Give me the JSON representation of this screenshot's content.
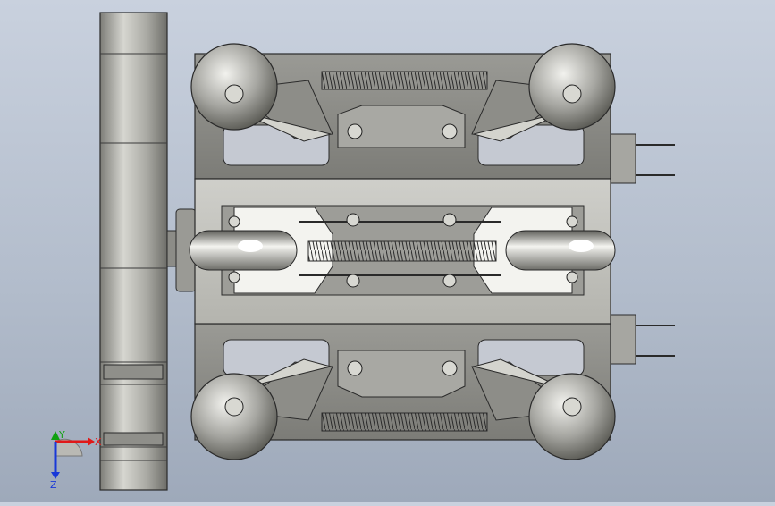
{
  "viewport": {
    "background_top": "#c9d1de",
    "background_bottom": "#9ea9ba",
    "part_color": "#b9b9b4",
    "edge_color": "#2a2a2a"
  },
  "triad": {
    "x_label": "X",
    "y_label": "Y",
    "z_label": "Z",
    "x_color": "#e01818",
    "y_color": "#10a010",
    "z_color": "#1838d8"
  }
}
